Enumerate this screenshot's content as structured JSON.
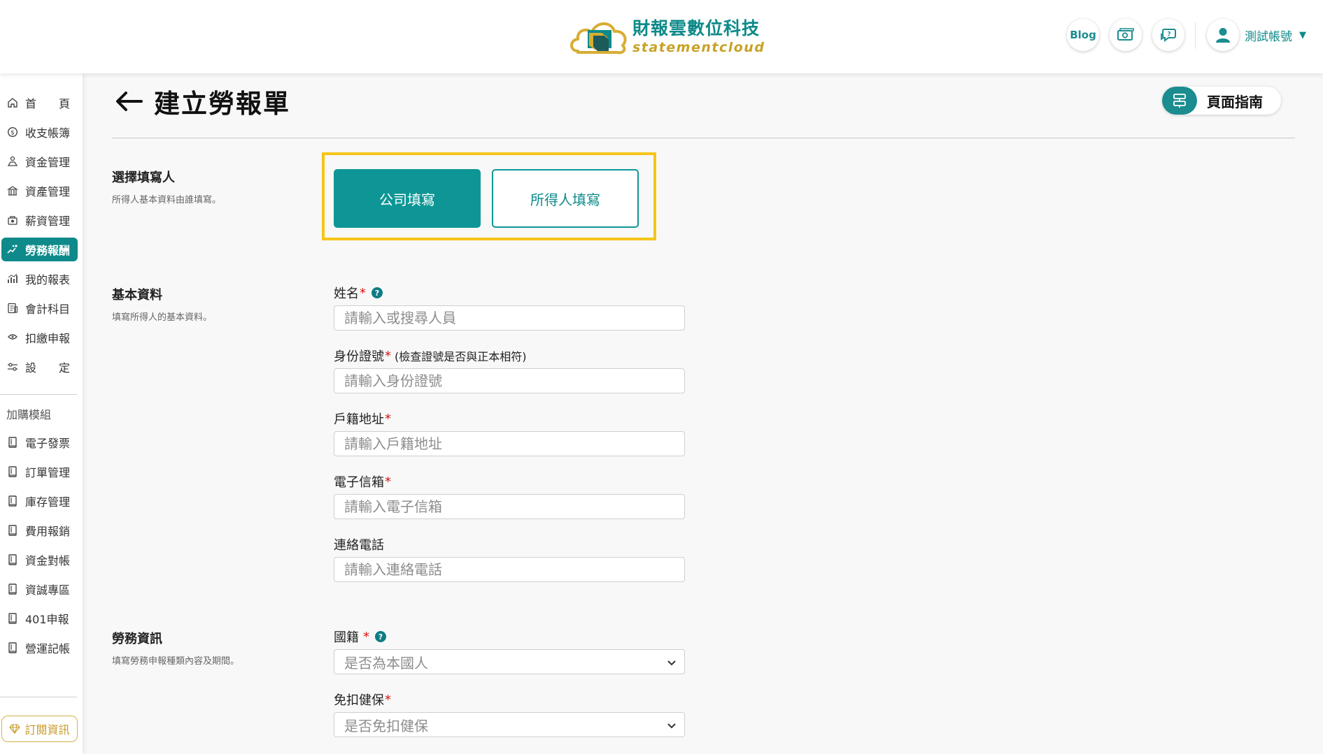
{
  "header": {
    "brand_cn": "財報雲數位科技",
    "brand_en": "statementcloud",
    "blog_label": "Blog",
    "account_name": "測試帳號"
  },
  "sidebar": {
    "items": [
      {
        "label": "首　　頁",
        "icon": "home-icon"
      },
      {
        "label": "收支帳簿",
        "icon": "coin-icon"
      },
      {
        "label": "資金管理",
        "icon": "fund-icon"
      },
      {
        "label": "資產管理",
        "icon": "building-icon"
      },
      {
        "label": "薪資管理",
        "icon": "payroll-icon"
      },
      {
        "label": "勞務報酬",
        "icon": "handshake-icon",
        "active": true
      },
      {
        "label": "我的報表",
        "icon": "chart-icon"
      },
      {
        "label": "會計科目",
        "icon": "ledger-icon"
      },
      {
        "label": "扣繳申報",
        "icon": "tax-icon"
      },
      {
        "label": "設　　定",
        "icon": "settings-icon"
      }
    ],
    "addon_group_label": "加購模組",
    "addons": [
      {
        "label": "電子發票"
      },
      {
        "label": "訂單管理"
      },
      {
        "label": "庫存管理"
      },
      {
        "label": "費用報銷"
      },
      {
        "label": "資金對帳"
      },
      {
        "label": "資誠專區"
      },
      {
        "label": "401申報"
      },
      {
        "label": "營運記帳"
      }
    ],
    "subscribe_label": "訂閱資訊"
  },
  "page": {
    "title": "建立勞報單",
    "guide_label": "頁面指南"
  },
  "section_filler": {
    "title": "選擇填寫人",
    "desc": "所得人基本資料由誰填寫。",
    "company_label": "公司填寫",
    "owner_label": "所得人填寫"
  },
  "section_basic": {
    "title": "基本資料",
    "desc": "填寫所得人的基本資料。",
    "name_label": "姓名",
    "name_placeholder": "請輸入或搜尋人員",
    "id_label": "身份證號",
    "id_note": "(檢查證號是否與正本相符)",
    "id_placeholder": "請輸入身份證號",
    "address_label": "戶籍地址",
    "address_placeholder": "請輸入戶籍地址",
    "email_label": "電子信箱",
    "email_placeholder": "請輸入電子信箱",
    "phone_label": "連絡電話",
    "phone_placeholder": "請輸入連絡電話"
  },
  "section_labor": {
    "title": "勞務資訊",
    "desc": "填寫勞務申報種類內容及期間。",
    "nationality_label": "國籍",
    "nationality_placeholder": "是否為本國人",
    "insurance_label": "免扣健保",
    "insurance_placeholder": "是否免扣健保"
  },
  "common": {
    "required_mark": "*",
    "help_mark": "?"
  },
  "colors": {
    "primary": "#0e8a8a",
    "highlight": "#f5c518",
    "gold": "#c9a227"
  }
}
